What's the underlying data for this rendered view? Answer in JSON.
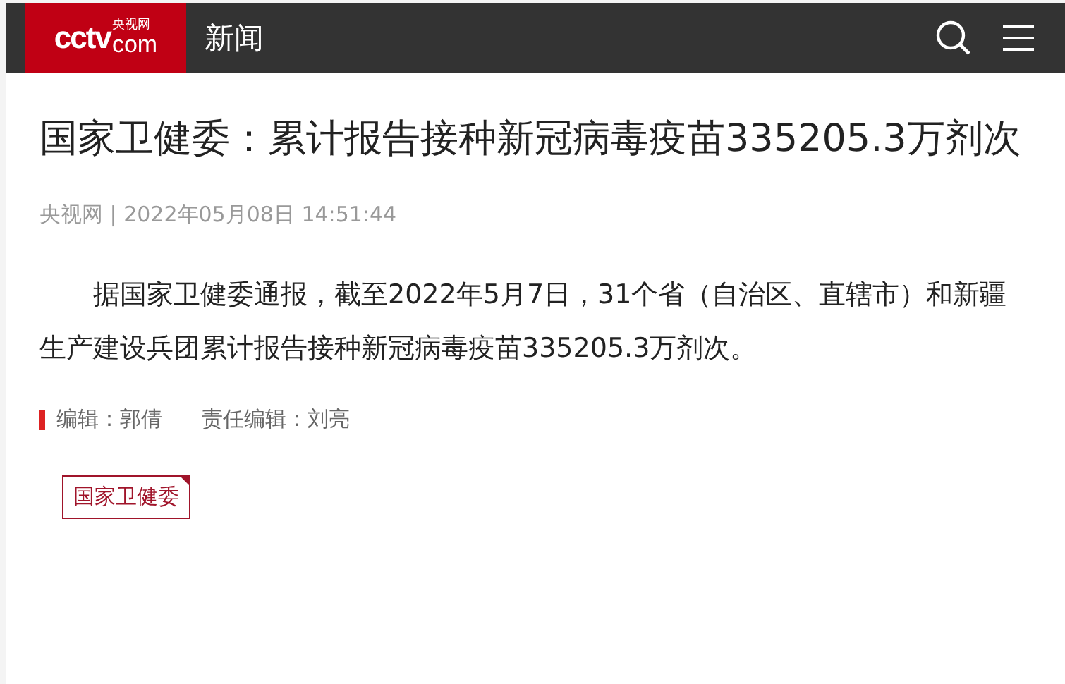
{
  "header": {
    "logo": {
      "main": "cctv",
      "suffix": "com",
      "caption": "央视网"
    },
    "section": "新闻"
  },
  "article": {
    "title": "国家卫健委：累计报告接种新冠病毒疫苗335205.3万剂次",
    "source": "央视网 | 2022年05月08日 14:51:44",
    "body": "据国家卫健委通报，截至2022年5月7日，31个省（自治区、直辖市）和新疆生产建设兵团累计报告接种新冠病毒疫苗335205.3万剂次。",
    "editors": [
      "编辑：郭倩",
      "责任编辑：刘亮"
    ],
    "tags": [
      "国家卫健委"
    ]
  }
}
